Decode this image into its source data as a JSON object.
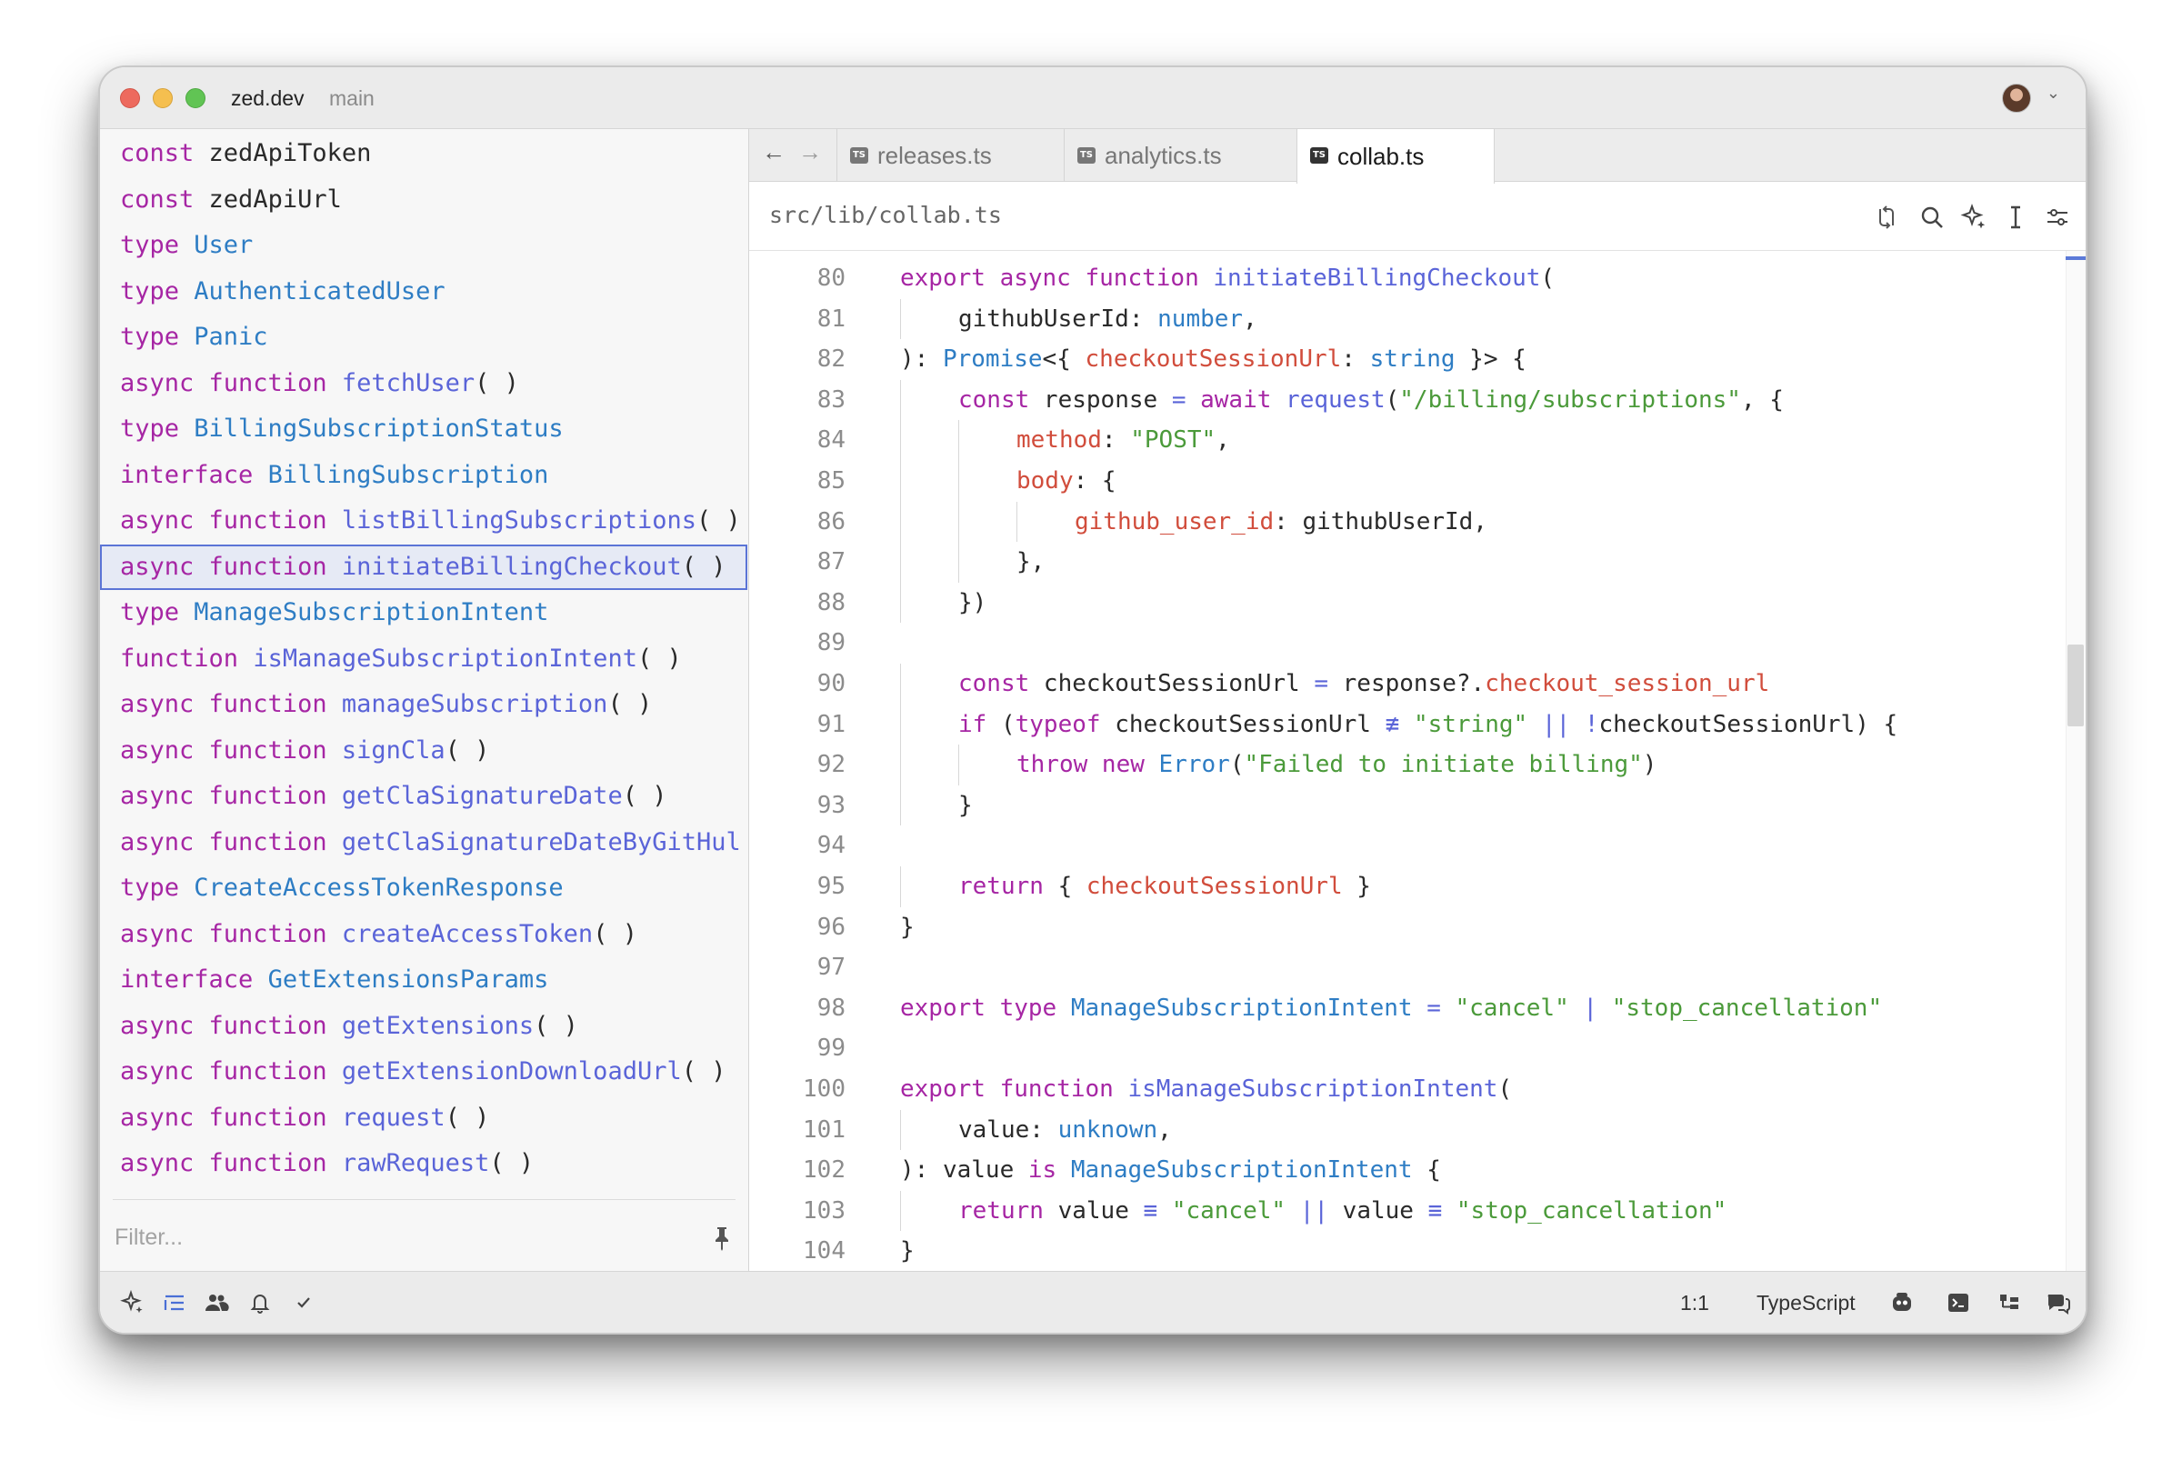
{
  "titlebar": {
    "project": "zed.dev",
    "branch": "main"
  },
  "outline": {
    "items": [
      {
        "kw": "const ",
        "name": "zedApiToken",
        "suffix": "",
        "style": "pl"
      },
      {
        "kw": "const ",
        "name": "zedApiUrl",
        "suffix": "",
        "style": "pl"
      },
      {
        "kw": "type ",
        "name": "User",
        "suffix": "",
        "style": "tp"
      },
      {
        "kw": "type ",
        "name": "AuthenticatedUser",
        "suffix": "",
        "style": "tp"
      },
      {
        "kw": "type ",
        "name": "Panic",
        "suffix": "",
        "style": "tp"
      },
      {
        "kw": "async function ",
        "name": "fetchUser",
        "suffix": "( )",
        "style": "fn"
      },
      {
        "kw": "type ",
        "name": "BillingSubscriptionStatus",
        "suffix": "",
        "style": "tp"
      },
      {
        "kw": "interface ",
        "name": "BillingSubscription",
        "suffix": "",
        "style": "tp"
      },
      {
        "kw": "async function ",
        "name": "listBillingSubscriptions",
        "suffix": "( )",
        "style": "fn"
      },
      {
        "kw": "async function ",
        "name": "initiateBillingCheckout",
        "suffix": "( )",
        "style": "fn",
        "selected": true
      },
      {
        "kw": "type ",
        "name": "ManageSubscriptionIntent",
        "suffix": "",
        "style": "tp"
      },
      {
        "kw": "function ",
        "name": "isManageSubscriptionIntent",
        "suffix": "( )",
        "style": "fn"
      },
      {
        "kw": "async function ",
        "name": "manageSubscription",
        "suffix": "( )",
        "style": "fn"
      },
      {
        "kw": "async function ",
        "name": "signCla",
        "suffix": "( )",
        "style": "fn"
      },
      {
        "kw": "async function ",
        "name": "getClaSignatureDate",
        "suffix": "( )",
        "style": "fn"
      },
      {
        "kw": "async function ",
        "name": "getClaSignatureDateByGitHul",
        "suffix": "",
        "style": "fn"
      },
      {
        "kw": "type ",
        "name": "CreateAccessTokenResponse",
        "suffix": "",
        "style": "tp"
      },
      {
        "kw": "async function ",
        "name": "createAccessToken",
        "suffix": "( )",
        "style": "fn"
      },
      {
        "kw": "interface ",
        "name": "GetExtensionsParams",
        "suffix": "",
        "style": "tp"
      },
      {
        "kw": "async function ",
        "name": "getExtensions",
        "suffix": "( )",
        "style": "fn"
      },
      {
        "kw": "async function ",
        "name": "getExtensionDownloadUrl",
        "suffix": "( )",
        "style": "fn"
      },
      {
        "kw": "async function ",
        "name": "request",
        "suffix": "( )",
        "style": "fn"
      },
      {
        "kw": "async function ",
        "name": "rawRequest",
        "suffix": "( )",
        "style": "fn"
      }
    ],
    "filter_placeholder": "Filter..."
  },
  "tabs": [
    {
      "label": "releases.ts",
      "active": false
    },
    {
      "label": "analytics.ts",
      "active": false
    },
    {
      "label": "collab.ts",
      "active": true
    }
  ],
  "tab_badge": "TS",
  "breadcrumb": "src/lib/collab.ts",
  "code_lines": [
    {
      "n": "80",
      "indent": 0,
      "tokens": [
        [
          "c-kw",
          "export async function "
        ],
        [
          "c-fn",
          "initiateBillingCheckout"
        ],
        [
          "",
          "("
        ]
      ]
    },
    {
      "n": "81",
      "indent": 1,
      "tokens": [
        [
          "",
          "githubUserId: "
        ],
        [
          "c-tp",
          "number"
        ],
        [
          "",
          ","
        ]
      ]
    },
    {
      "n": "82",
      "indent": 0,
      "tokens": [
        [
          "",
          "): "
        ],
        [
          "c-tp",
          "Promise"
        ],
        [
          "",
          "<{ "
        ],
        [
          "c-prop",
          "checkoutSessionUrl"
        ],
        [
          "",
          ": "
        ],
        [
          "c-tp",
          "string"
        ],
        [
          "",
          " }> {"
        ]
      ]
    },
    {
      "n": "83",
      "indent": 1,
      "tokens": [
        [
          "c-kw",
          "const "
        ],
        [
          "",
          "response "
        ],
        [
          "c-op",
          "= "
        ],
        [
          "c-kw",
          "await "
        ],
        [
          "c-fn",
          "request"
        ],
        [
          "",
          "("
        ],
        [
          "c-str",
          "\"/billing/subscriptions\""
        ],
        [
          "",
          ", {"
        ]
      ]
    },
    {
      "n": "84",
      "indent": 2,
      "tokens": [
        [
          "c-prop",
          "method"
        ],
        [
          "",
          ": "
        ],
        [
          "c-str",
          "\"POST\""
        ],
        [
          "",
          ","
        ]
      ]
    },
    {
      "n": "85",
      "indent": 2,
      "tokens": [
        [
          "c-prop",
          "body"
        ],
        [
          "",
          ": {"
        ]
      ]
    },
    {
      "n": "86",
      "indent": 3,
      "tokens": [
        [
          "c-prop",
          "github_user_id"
        ],
        [
          "",
          ": githubUserId,"
        ]
      ]
    },
    {
      "n": "87",
      "indent": 2,
      "tokens": [
        [
          "",
          "},"
        ]
      ]
    },
    {
      "n": "88",
      "indent": 1,
      "tokens": [
        [
          "",
          "})"
        ]
      ]
    },
    {
      "n": "89",
      "indent": 0,
      "tokens": []
    },
    {
      "n": "90",
      "indent": 1,
      "tokens": [
        [
          "c-kw",
          "const "
        ],
        [
          "",
          "checkoutSessionUrl "
        ],
        [
          "c-op",
          "= "
        ],
        [
          "",
          "response?."
        ],
        [
          "c-prop",
          "checkout_session_url"
        ]
      ]
    },
    {
      "n": "91",
      "indent": 1,
      "tokens": [
        [
          "c-kw",
          "if "
        ],
        [
          "",
          "("
        ],
        [
          "c-kw",
          "typeof "
        ],
        [
          "",
          "checkoutSessionUrl "
        ],
        [
          "c-op",
          "≢ "
        ],
        [
          "c-str",
          "\"string\""
        ],
        [
          "c-op",
          " || "
        ],
        [
          "c-op",
          "!"
        ],
        [
          "",
          "checkoutSessionUrl) {"
        ]
      ]
    },
    {
      "n": "92",
      "indent": 2,
      "tokens": [
        [
          "c-kw",
          "throw new "
        ],
        [
          "c-tp",
          "Error"
        ],
        [
          "",
          "("
        ],
        [
          "c-str",
          "\"Failed to initiate billing\""
        ],
        [
          "",
          ")"
        ]
      ]
    },
    {
      "n": "93",
      "indent": 1,
      "tokens": [
        [
          "",
          "}"
        ]
      ]
    },
    {
      "n": "94",
      "indent": 0,
      "tokens": []
    },
    {
      "n": "95",
      "indent": 1,
      "tokens": [
        [
          "c-kw",
          "return "
        ],
        [
          "",
          "{ "
        ],
        [
          "c-prop",
          "checkoutSessionUrl"
        ],
        [
          "",
          " }"
        ]
      ]
    },
    {
      "n": "96",
      "indent": 0,
      "tokens": [
        [
          "",
          "}"
        ]
      ]
    },
    {
      "n": "97",
      "indent": 0,
      "tokens": []
    },
    {
      "n": "98",
      "indent": 0,
      "tokens": [
        [
          "c-kw",
          "export type "
        ],
        [
          "c-tp",
          "ManageSubscriptionIntent "
        ],
        [
          "c-op",
          "= "
        ],
        [
          "c-str",
          "\"cancel\""
        ],
        [
          "c-op",
          " | "
        ],
        [
          "c-str",
          "\"stop_cancellation\""
        ]
      ]
    },
    {
      "n": "99",
      "indent": 0,
      "tokens": []
    },
    {
      "n": "100",
      "indent": 0,
      "tokens": [
        [
          "c-kw",
          "export function "
        ],
        [
          "c-fn",
          "isManageSubscriptionIntent"
        ],
        [
          "",
          "("
        ]
      ]
    },
    {
      "n": "101",
      "indent": 1,
      "tokens": [
        [
          "",
          "value: "
        ],
        [
          "c-tp",
          "unknown"
        ],
        [
          "",
          ","
        ]
      ]
    },
    {
      "n": "102",
      "indent": 0,
      "tokens": [
        [
          "",
          "): value "
        ],
        [
          "c-kw",
          "is "
        ],
        [
          "c-tp",
          "ManageSubscriptionIntent"
        ],
        [
          "",
          " {"
        ]
      ]
    },
    {
      "n": "103",
      "indent": 1,
      "tokens": [
        [
          "c-kw",
          "return "
        ],
        [
          "",
          "value "
        ],
        [
          "c-op",
          "≡ "
        ],
        [
          "c-str",
          "\"cancel\""
        ],
        [
          "c-op",
          " || "
        ],
        [
          "",
          "value "
        ],
        [
          "c-op",
          "≡ "
        ],
        [
          "c-str",
          "\"stop_cancellation\""
        ]
      ]
    },
    {
      "n": "104",
      "indent": 0,
      "tokens": [
        [
          "",
          "}"
        ]
      ]
    }
  ],
  "statusbar": {
    "cursor": "1:1",
    "language": "TypeScript"
  },
  "colors": {
    "keyword": "#a626a4",
    "type": "#2e7dc4",
    "function": "#5a64d8",
    "string": "#4b9a3a",
    "property": "#d14d3c",
    "selection_border": "#5b74d6"
  },
  "icons": {
    "nav_back": "←",
    "nav_forward": "→",
    "avatar_caret": "⌄"
  }
}
